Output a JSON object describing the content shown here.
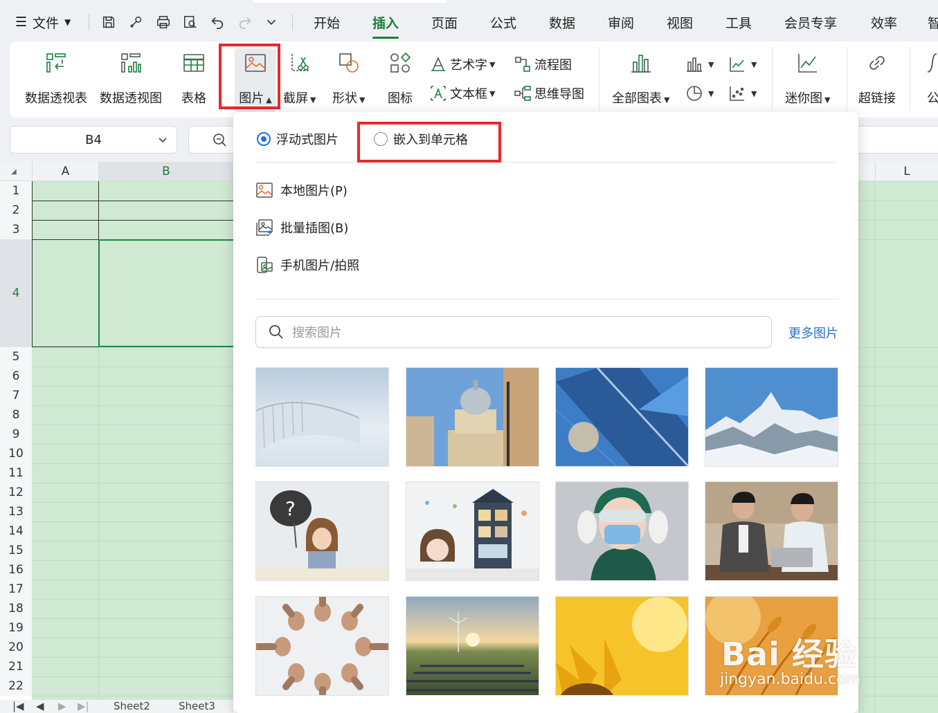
{
  "menu": {
    "file_label": "文件",
    "tabs": [
      {
        "label": "开始"
      },
      {
        "label": "插入"
      },
      {
        "label": "页面"
      },
      {
        "label": "公式"
      },
      {
        "label": "数据"
      },
      {
        "label": "审阅"
      },
      {
        "label": "视图"
      },
      {
        "label": "工具"
      },
      {
        "label": "会员专享"
      },
      {
        "label": "效率"
      },
      {
        "label": "智"
      }
    ],
    "active_tab": "插入"
  },
  "ribbon": {
    "pivot_table": "数据透视表",
    "pivot_chart": "数据透视图",
    "table": "表格",
    "picture": "图片",
    "screenshot": "截屏",
    "shape": "形状",
    "icon": "图标",
    "wordart": "艺术字",
    "textbox": "文本框",
    "flowchart": "流程图",
    "mindmap": "思维导图",
    "all_charts": "全部图表",
    "sparkline": "迷你图",
    "hyperlink": "超链接",
    "formula": "公"
  },
  "namebox": {
    "value": "B4"
  },
  "grid": {
    "columns": [
      "A",
      "B",
      "L"
    ],
    "rows": [
      "1",
      "2",
      "3",
      "4",
      "5",
      "6",
      "7",
      "8",
      "9",
      "10",
      "11",
      "12",
      "13",
      "14",
      "15",
      "16",
      "17",
      "18",
      "19",
      "20",
      "21",
      "22"
    ]
  },
  "panel": {
    "radio_floating": "浮动式图片",
    "radio_embed": "嵌入到单元格",
    "local_picture": "本地图片(P)",
    "batch_insert": "批量插图(B)",
    "phone_picture": "手机图片/拍照",
    "search_placeholder": "搜索图片",
    "more_pictures": "更多图片"
  },
  "sheets": [
    "Sheet2",
    "Sheet3"
  ],
  "watermark": {
    "brand": "Bai 经验",
    "url": "jingyan.baidu.com"
  },
  "colors": {
    "accent_green": "#1a7f3c",
    "highlight_red": "#e8282b",
    "link_blue": "#2a6fcf",
    "selection_fill": "#cfe9d3"
  }
}
